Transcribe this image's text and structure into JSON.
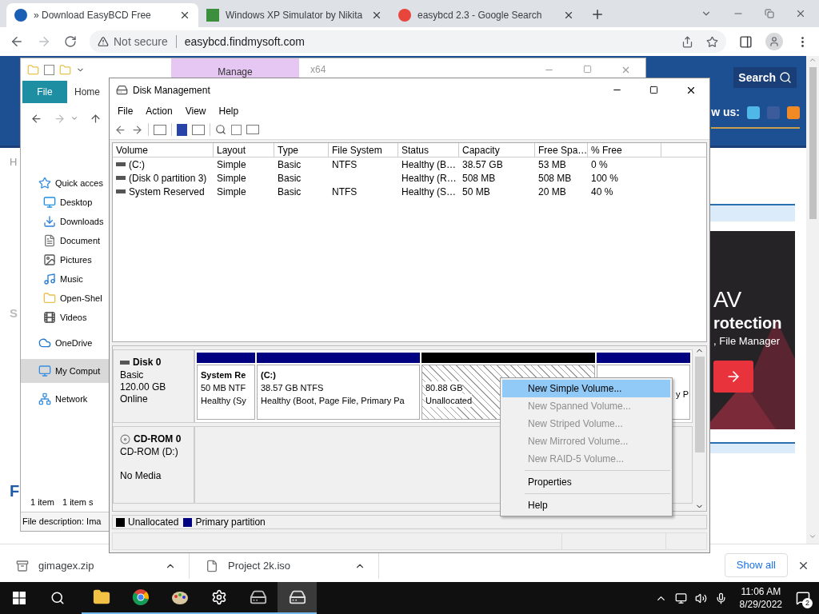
{
  "browser": {
    "tabs": [
      {
        "title": "» Download EasyBCD Free",
        "selected": true
      },
      {
        "title": "Windows XP Simulator by Nikita",
        "selected": false
      },
      {
        "title": "easybcd 2.3 - Google Search",
        "selected": false
      }
    ],
    "security": "Not secure",
    "url": "easybcd.findmysoft.com"
  },
  "web_page": {
    "search_button": "Search",
    "follow_label": "w us:",
    "ad_lines": [
      "AV",
      "rotection",
      ", File Manager"
    ],
    "fragments": [
      "H",
      "S",
      "F"
    ]
  },
  "explorer": {
    "context_tab": "Manage",
    "title": "x64",
    "ribbon_tabs": [
      {
        "label": "File",
        "kind": "file"
      },
      {
        "label": "Home",
        "kind": "tab"
      }
    ],
    "nav": [
      {
        "label": "Quick acces",
        "kind": "star",
        "selected": false,
        "children": [
          {
            "label": "Desktop",
            "kind": "desktop",
            "selected": false
          },
          {
            "label": "Downloads",
            "kind": "download",
            "selected": false
          },
          {
            "label": "Document",
            "kind": "document",
            "selected": false
          },
          {
            "label": "Pictures",
            "kind": "pictures",
            "selected": false
          },
          {
            "label": "Music",
            "kind": "music",
            "selected": false
          },
          {
            "label": "Open-Shel",
            "kind": "folder",
            "selected": false
          },
          {
            "label": "Videos",
            "kind": "video",
            "selected": false
          }
        ]
      },
      {
        "label": "OneDrive",
        "kind": "cloud",
        "selected": false
      },
      {
        "label": "My Comput",
        "kind": "computer",
        "selected": true
      },
      {
        "label": "Network",
        "kind": "network",
        "selected": false
      }
    ],
    "item_count": "1 item",
    "selection": "1 item s",
    "details": "File description: Ima"
  },
  "disk_management": {
    "title": "Disk Management",
    "menu": [
      "File",
      "Action",
      "View",
      "Help"
    ],
    "columns": [
      "Volume",
      "Layout",
      "Type",
      "File System",
      "Status",
      "Capacity",
      "Free Spa…",
      "% Free"
    ],
    "volumes": [
      {
        "volume": "(C:)",
        "layout": "Simple",
        "type": "Basic",
        "file_system": "NTFS",
        "status": "Healthy (B…",
        "capacity": "38.57 GB",
        "free_space": "53 MB",
        "percent_free": "0 %"
      },
      {
        "volume": "(Disk 0 partition 3)",
        "layout": "Simple",
        "type": "Basic",
        "status": "Healthy (R…",
        "capacity": "508 MB",
        "free_space": "508 MB",
        "percent_free": "100 %"
      },
      {
        "volume": "System Reserved",
        "layout": "Simple",
        "type": "Basic",
        "file_system": "NTFS",
        "status": "Healthy (S…",
        "capacity": "50 MB",
        "free_space": "20 MB",
        "percent_free": "40 %"
      }
    ],
    "disks": [
      {
        "name": "Disk 0",
        "kind": "disk",
        "info": [
          "Basic",
          "120.00 GB"
        ],
        "status": "Online",
        "partitions": [
          {
            "kind": "primary",
            "name": "System Re",
            "lines": [
              "50 MB NTF",
              "Healthy (Sy"
            ]
          },
          {
            "kind": "primary",
            "name": "(C:)",
            "lines": [
              "38.57 GB NTFS",
              "Healthy (Boot, Page File, Primary Pa"
            ]
          },
          {
            "kind": "unallocated",
            "lines": [
              "80.88 GB",
              "Unallocated"
            ]
          },
          {
            "kind": "primary",
            "lines": [
              "y P"
            ]
          }
        ]
      },
      {
        "name": "CD-ROM 0",
        "kind": "cdrom",
        "info": [
          "CD-ROM (D:)"
        ],
        "status": "No Media"
      }
    ],
    "legend": [
      {
        "label": "Unallocated",
        "color": "#000000"
      },
      {
        "label": "Primary partition",
        "color": "#000080"
      }
    ],
    "context_menu": [
      {
        "kind": "item",
        "label": "New Simple Volume...",
        "selected": true,
        "disabled": false
      },
      {
        "kind": "item",
        "label": "New Spanned Volume...",
        "selected": false,
        "disabled": true
      },
      {
        "kind": "item",
        "label": "New Striped Volume...",
        "selected": false,
        "disabled": true
      },
      {
        "kind": "item",
        "label": "New Mirrored Volume...",
        "selected": false,
        "disabled": true
      },
      {
        "kind": "item",
        "label": "New RAID-5 Volume...",
        "selected": false,
        "disabled": true
      },
      {
        "kind": "separator"
      },
      {
        "kind": "item",
        "label": "Properties",
        "selected": false,
        "disabled": false
      },
      {
        "kind": "separator"
      },
      {
        "kind": "item",
        "label": "Help",
        "selected": false,
        "disabled": false
      }
    ]
  },
  "downloads": {
    "items": [
      {
        "name": "gimagex.zip",
        "kind": "zip"
      },
      {
        "name": "Project 2k.iso",
        "kind": "iso"
      }
    ],
    "show_all": "Show all"
  },
  "taskbar": {
    "apps": [
      {
        "kind": "explorer",
        "selected": false
      },
      {
        "kind": "chrome",
        "selected": false
      },
      {
        "kind": "paint",
        "selected": false
      },
      {
        "kind": "settings",
        "selected": false
      },
      {
        "kind": "simulator",
        "selected": false
      },
      {
        "kind": "drive",
        "selected": true
      }
    ],
    "time": "11:06 AM",
    "date": "8/29/2022",
    "notifications": "2"
  }
}
